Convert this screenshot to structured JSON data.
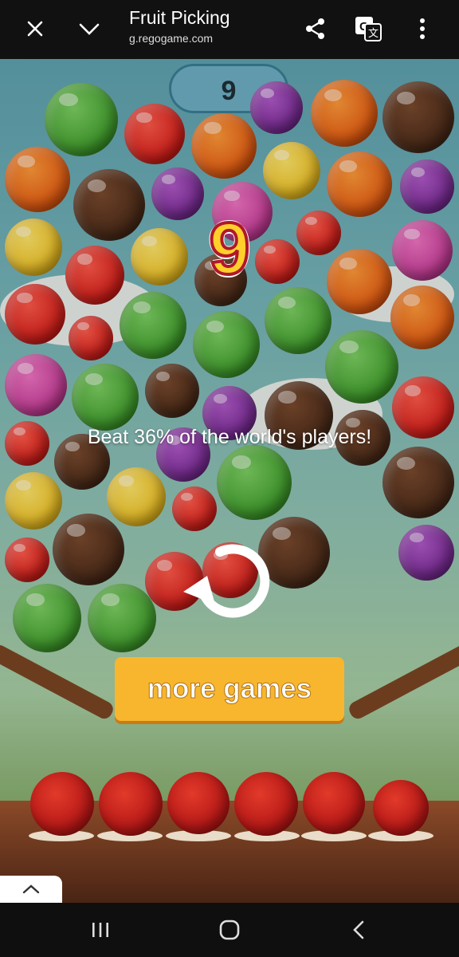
{
  "browser": {
    "title": "Fruit Picking",
    "url": "g.regogame.com",
    "icons": [
      "close-icon",
      "chevron-down-icon",
      "share-icon",
      "translate-icon",
      "more-vert-icon"
    ]
  },
  "game": {
    "top_score": "9",
    "final_score": "9",
    "beat_text": "Beat 36% of the world's players!",
    "replay_icon": "replay-icon",
    "more_games_label": "more games"
  },
  "bottom": {
    "tab_toggle_icon": "chevron-up-icon"
  },
  "navbar": {
    "icons": [
      "recents-icon",
      "home-icon",
      "back-icon"
    ]
  }
}
